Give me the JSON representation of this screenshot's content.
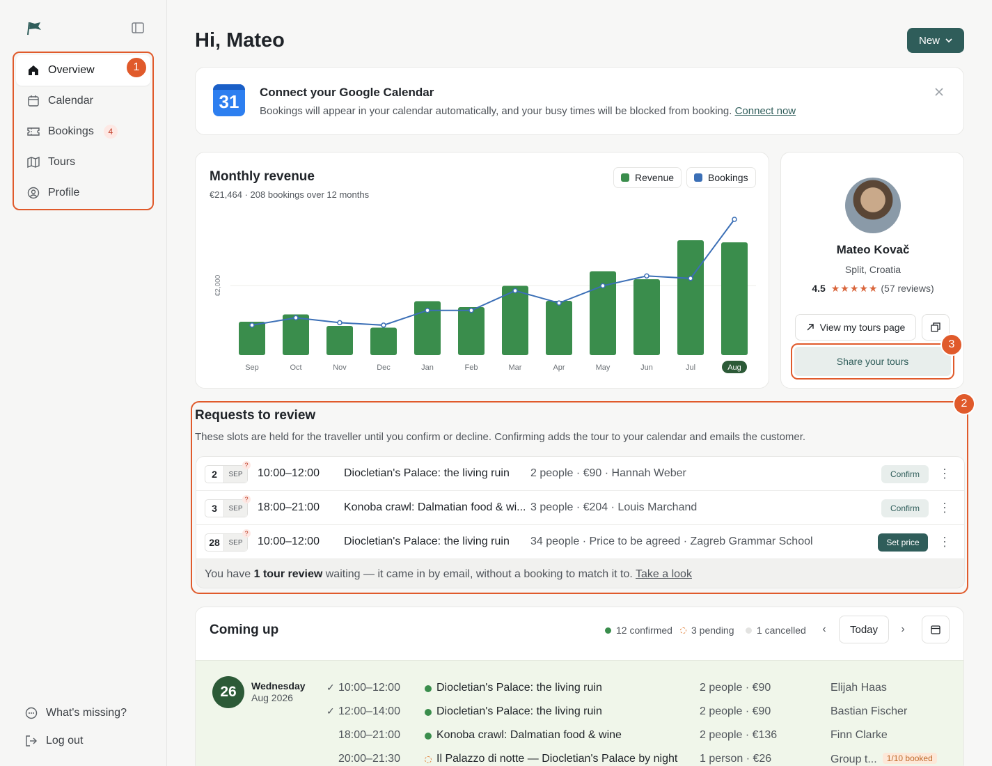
{
  "sidebar": {
    "nav": [
      {
        "label": "Overview",
        "icon": "home-icon",
        "active": true
      },
      {
        "label": "Calendar",
        "icon": "calendar-icon"
      },
      {
        "label": "Bookings",
        "icon": "ticket-icon",
        "count": "4"
      },
      {
        "label": "Tours",
        "icon": "map-icon"
      },
      {
        "label": "Profile",
        "icon": "user-circle-icon"
      }
    ],
    "bottom": [
      {
        "label": "What's missing?",
        "icon": "chat-icon"
      },
      {
        "label": "Log out",
        "icon": "logout-icon"
      }
    ]
  },
  "markers": {
    "m1": "1",
    "m2": "2",
    "m3": "3"
  },
  "header": {
    "greeting": "Hi, Mateo",
    "new_label": "New"
  },
  "gcal": {
    "icon_text": "31",
    "title": "Connect your Google Calendar",
    "desc": "Bookings will appear in your calendar automatically, and your busy times will be blocked from booking.",
    "link": "Connect now"
  },
  "revenue": {
    "title": "Monthly revenue",
    "subtitle": "€21,464 · 208 bookings over 12 months",
    "legend_revenue": "Revenue",
    "legend_bookings": "Bookings"
  },
  "chart_data": {
    "type": "bar",
    "categories": [
      "Sep",
      "Oct",
      "Nov",
      "Dec",
      "Jan",
      "Feb",
      "Mar",
      "Apr",
      "May",
      "Jun",
      "Jul",
      "Aug"
    ],
    "selected_category": "Aug",
    "ylabel": "€2,000",
    "gridline_value": 2000,
    "ylim": [
      0,
      4000
    ],
    "series": [
      {
        "name": "Revenue",
        "color": "#3a8d4c",
        "type": "bar",
        "values": [
          960,
          1170,
          840,
          790,
          1550,
          1380,
          1990,
          1560,
          2410,
          2180,
          3300,
          3240
        ]
      },
      {
        "name": "Bookings",
        "color": "#3b6fb6",
        "type": "line",
        "values": [
          14,
          17,
          15,
          14,
          20,
          20,
          28,
          23,
          30,
          34,
          33,
          57
        ]
      }
    ]
  },
  "profile": {
    "name": "Mateo Kovač",
    "location": "Split, Croatia",
    "rating": "4.5",
    "stars": "★★★★★",
    "reviews": "(57 reviews)",
    "view_label": "View my tours page",
    "share_label": "Share your tours"
  },
  "requests": {
    "title": "Requests to review",
    "desc": "These slots are held for the traveller until you confirm or decline. Confirming adds the tour to your calendar and emails the customer.",
    "rows": [
      {
        "day": "2",
        "month": "SEP",
        "time": "10:00–12:00",
        "tour": "Diocletian's Palace: the living ruin",
        "meta": "2 people · €90 · Hannah Weber",
        "action": "Confirm"
      },
      {
        "day": "3",
        "month": "SEP",
        "time": "18:00–21:00",
        "tour": "Konoba crawl: Dalmatian food & wi...",
        "meta": "3 people · €204 · Louis Marchand",
        "action": "Confirm"
      },
      {
        "day": "28",
        "month": "SEP",
        "time": "10:00–12:00",
        "tour": "Diocletian's Palace: the living ruin",
        "meta": "34 people · Price to be agreed · Zagreb Grammar School",
        "action": "Set price"
      }
    ],
    "note_prefix": "You have",
    "note_bold": "1 tour review",
    "note_suffix": "waiting — it came in by email, without a booking to match it to.",
    "note_link": "Take a look"
  },
  "coming": {
    "title": "Coming up",
    "confirmed": "12 confirmed",
    "pending": "3 pending",
    "cancelled": "1 cancelled",
    "today_label": "Today",
    "day_num": "26",
    "day_name": "Wednesday",
    "day_sub": "Aug 2026",
    "events": [
      {
        "check": "✓",
        "time": "10:00–12:00",
        "tour": "Diocletian's Palace: the living ruin",
        "people": "2 people · €90",
        "customer": "Elijah Haas",
        "status": "confirmed"
      },
      {
        "check": "✓",
        "time": "12:00–14:00",
        "tour": "Diocletian's Palace: the living ruin",
        "people": "2 people · €90",
        "customer": "Bastian Fischer",
        "status": "confirmed"
      },
      {
        "check": "",
        "time": "18:00–21:00",
        "tour": "Konoba crawl: Dalmatian food & wine",
        "people": "2 people · €136",
        "customer": "Finn Clarke",
        "status": "confirmed"
      },
      {
        "check": "",
        "time": "20:00–21:30",
        "tour": "Il Palazzo di notte — Diocletian's Palace by night",
        "people": "1 person · €26",
        "customer": "Group t...",
        "tag": "1/10 booked",
        "status": "pending"
      }
    ]
  }
}
